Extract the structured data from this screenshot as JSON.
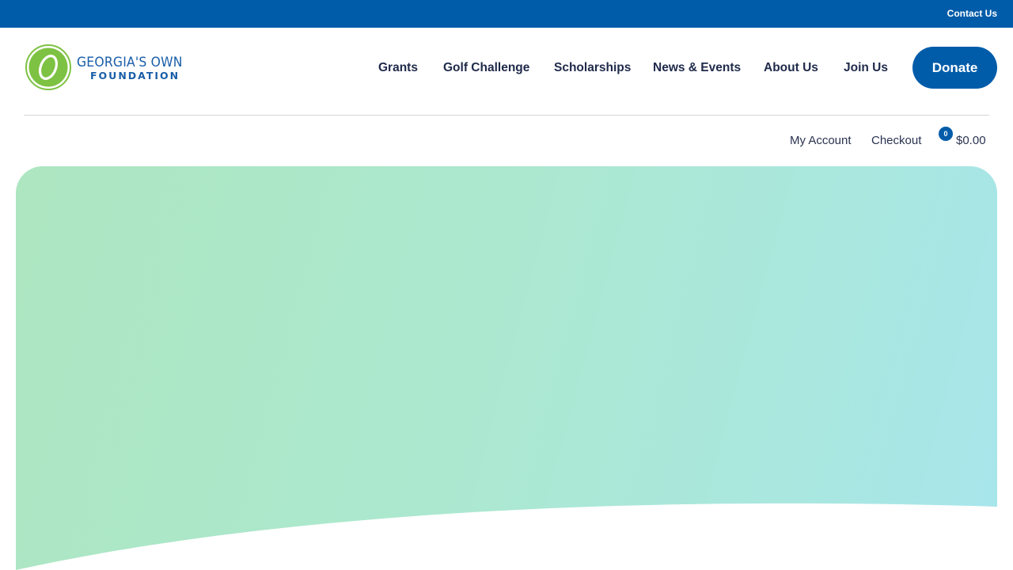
{
  "topbar": {
    "contact_label": "Contact Us"
  },
  "logo": {
    "line1": "GEORGIA'S OWN",
    "line2": "FOUNDATION"
  },
  "nav": {
    "items": [
      {
        "label": "Grants"
      },
      {
        "label": "Golf Challenge"
      },
      {
        "label": "Scholarships"
      },
      {
        "label": "News & Events"
      },
      {
        "label": "About Us"
      },
      {
        "label": "Join Us"
      }
    ],
    "donate_label": "Donate"
  },
  "account": {
    "my_account_label": "My Account",
    "checkout_label": "Checkout",
    "cart_count": "0",
    "cart_total": "$0.00"
  },
  "colors": {
    "brand_blue": "#005ca9",
    "logo_green": "#7dc242",
    "hero_gradient_start": "#ade6c0",
    "hero_gradient_end": "#a7e6ec"
  }
}
